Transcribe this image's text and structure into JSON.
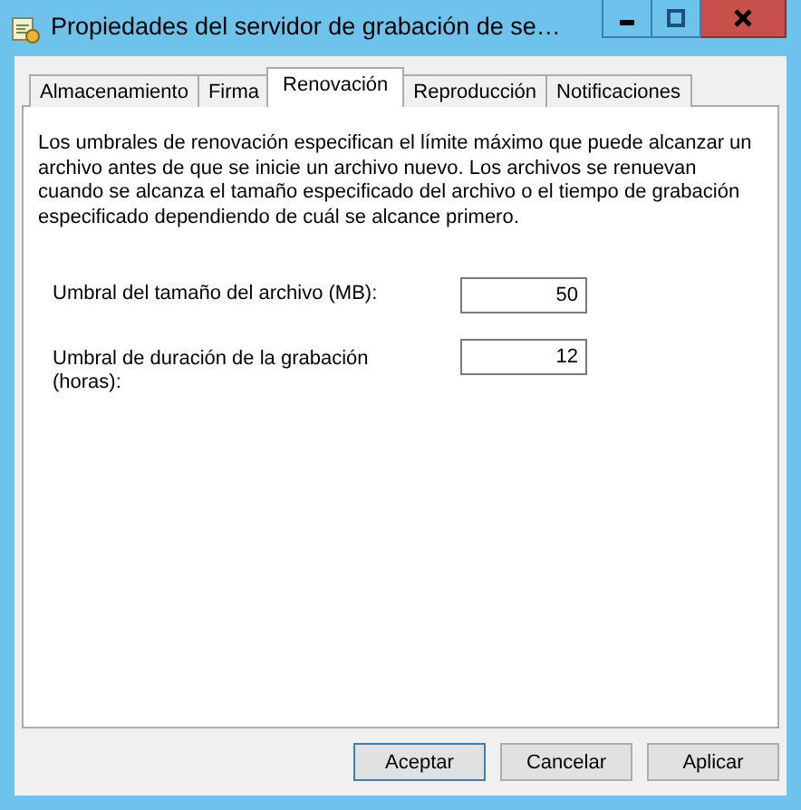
{
  "window": {
    "title": "Propiedades del servidor de grabación de se…"
  },
  "tabs": [
    {
      "label": "Almacenamiento",
      "selected": false
    },
    {
      "label": "Firma",
      "selected": false
    },
    {
      "label": "Renovación",
      "selected": true
    },
    {
      "label": "Reproducción",
      "selected": false
    },
    {
      "label": "Notificaciones",
      "selected": false
    }
  ],
  "description": "Los umbrales de renovación especifican el límite máximo que puede alcanzar un archivo antes de que se inicie un archivo nuevo. Los archivos se renuevan cuando se alcanza el tamaño especificado del archivo o el tiempo de grabación especificado dependiendo de cuál se alcance primero.",
  "fields": [
    {
      "label": "Umbral del tamaño del archivo (MB):",
      "value": "50"
    },
    {
      "label": "Umbral de duración de la grabación (horas):",
      "value": "12"
    }
  ],
  "buttons": [
    {
      "label": "Aceptar",
      "selected": true
    },
    {
      "label": "Cancelar",
      "selected": false
    },
    {
      "label": "Aplicar",
      "selected": false
    }
  ]
}
